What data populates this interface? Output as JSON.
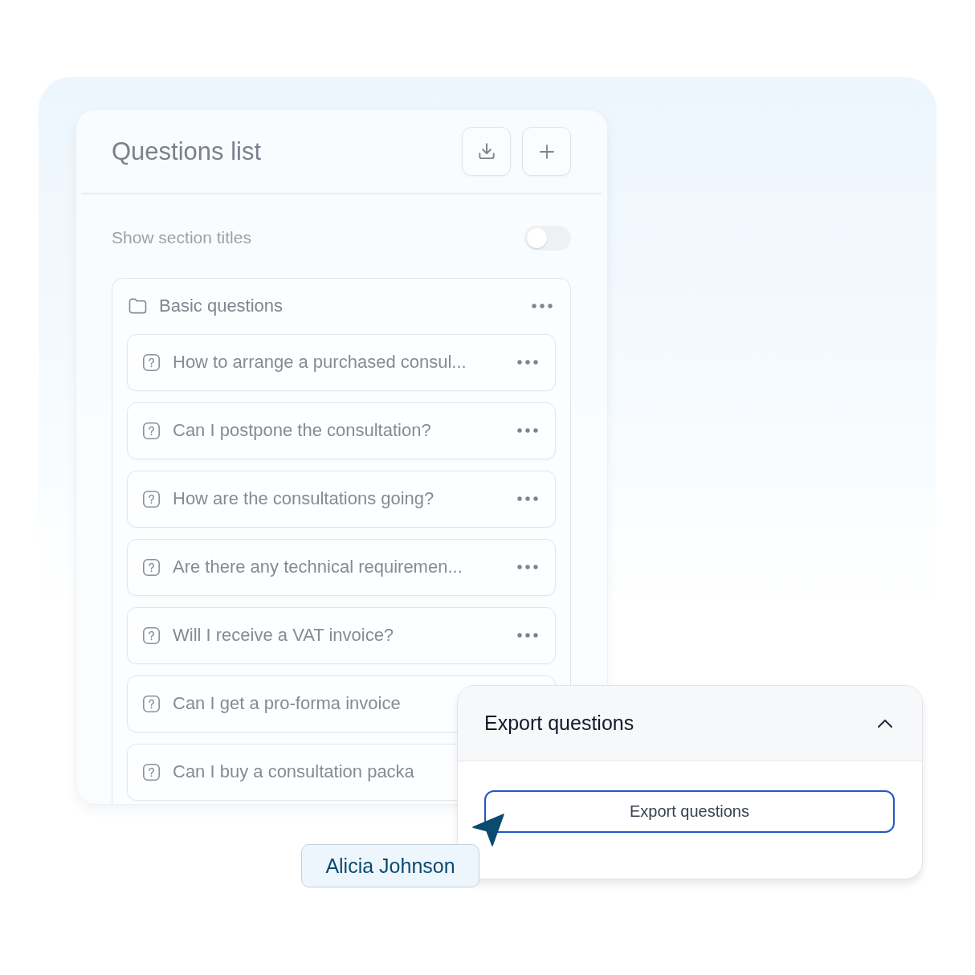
{
  "questions_panel": {
    "title": "Questions list",
    "toggle": {
      "label": "Show section titles",
      "on": false
    },
    "section": {
      "title": "Basic questions",
      "questions": [
        {
          "text": "How to arrange a purchased consul...",
          "menu": true
        },
        {
          "text": "Can I postpone the consultation?",
          "menu": true
        },
        {
          "text": "How are the consultations going?",
          "menu": true
        },
        {
          "text": "Are there any technical requiremen...",
          "menu": true
        },
        {
          "text": "Will I receive a VAT invoice?",
          "menu": true
        },
        {
          "text": "Can I get a pro-forma invoice",
          "menu": false
        },
        {
          "text": "Can I buy a consultation packa",
          "menu": false
        }
      ]
    }
  },
  "export_panel": {
    "title": "Export questions",
    "expanded": true,
    "button": "Export questions"
  },
  "cursor": {
    "name": "Alicia Johnson"
  }
}
